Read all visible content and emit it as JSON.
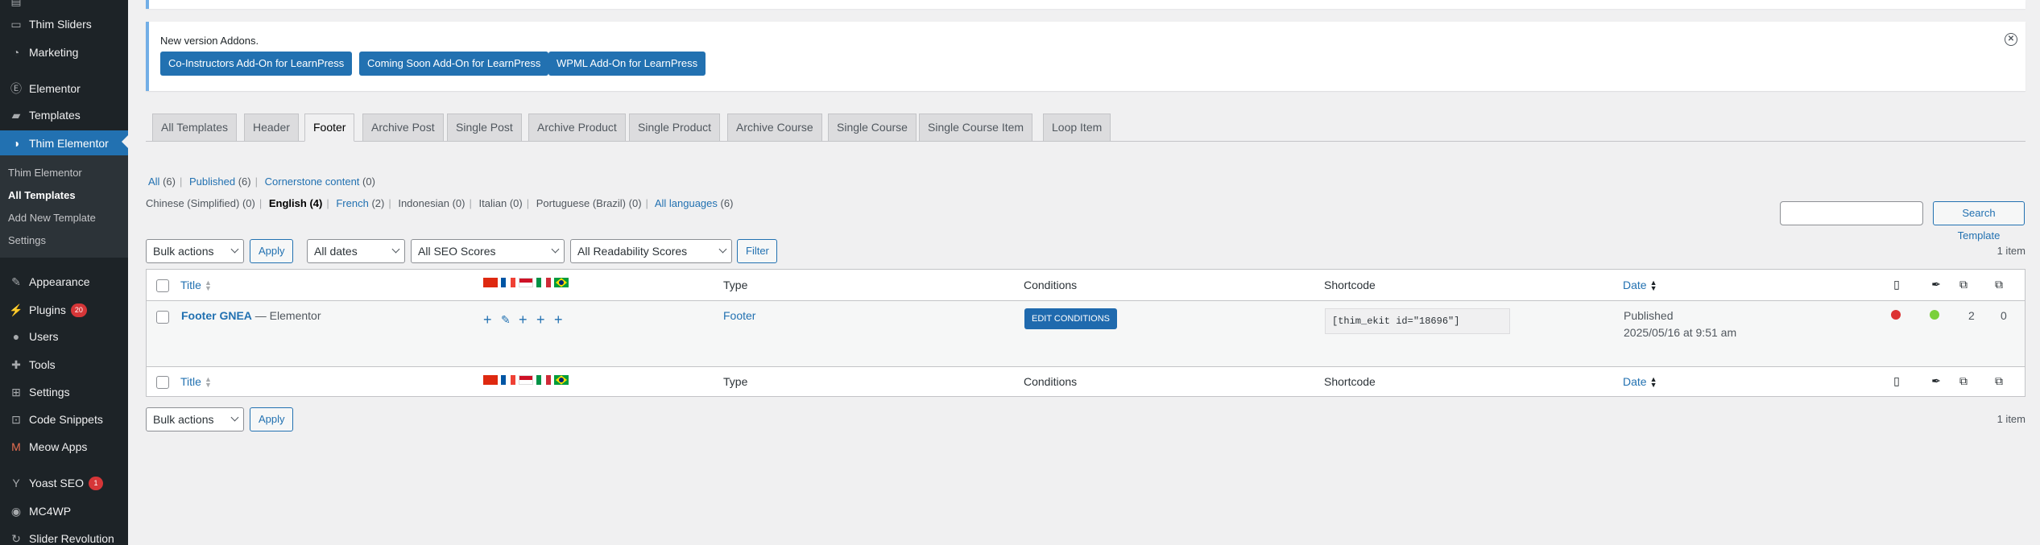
{
  "sidebar": {
    "items": [
      {
        "label": "Thim Sliders",
        "icon": "slider-icon",
        "glyph": "▭"
      },
      {
        "label": "Marketing",
        "icon": "marketing-icon",
        "glyph": "◔"
      },
      {
        "label": "Elementor",
        "icon": "elementor-icon",
        "glyph": "Ⓔ"
      },
      {
        "label": "Templates",
        "icon": "folder-icon",
        "glyph": "▰"
      },
      {
        "label": "Thim Elementor",
        "icon": "thim-icon",
        "glyph": "◑"
      },
      {
        "label": "Appearance",
        "icon": "brush-icon",
        "glyph": "✎"
      },
      {
        "label": "Plugins",
        "icon": "plug-icon",
        "glyph": "⚡",
        "badge": "20"
      },
      {
        "label": "Users",
        "icon": "user-icon",
        "glyph": "●"
      },
      {
        "label": "Tools",
        "icon": "wrench-icon",
        "glyph": "✚"
      },
      {
        "label": "Settings",
        "icon": "settings-icon",
        "glyph": "⊞"
      },
      {
        "label": "Code Snippets",
        "icon": "code-icon",
        "glyph": "⊡"
      },
      {
        "label": "Meow Apps",
        "icon": "meow-icon",
        "glyph": "M"
      },
      {
        "label": "Yoast SEO",
        "icon": "yoast-icon",
        "glyph": "Y",
        "badge": "1"
      },
      {
        "label": "MC4WP",
        "icon": "mc4wp-icon",
        "glyph": "◉"
      },
      {
        "label": "Slider Revolution",
        "icon": "revolution-icon",
        "glyph": "↻"
      }
    ],
    "submenu": [
      "Thim Elementor",
      "All Templates",
      "Add New Template",
      "Settings"
    ]
  },
  "notice": {
    "title": "New version Addons.",
    "buttons": [
      "Co-Instructors Add-On for LearnPress",
      "Coming Soon Add-On for LearnPress",
      "WPML Add-On for LearnPress"
    ]
  },
  "tabs": [
    "All Templates",
    "Header",
    "Footer",
    "Archive Post",
    "Single Post",
    "Archive Product",
    "Single Product",
    "Archive Course",
    "Single Course",
    "Single Course Item",
    "Loop Item"
  ],
  "status_links": {
    "all": "All",
    "all_count": "(6)",
    "published": "Published",
    "published_count": "(6)",
    "cornerstone": "Cornerstone content",
    "cornerstone_count": "(0)"
  },
  "language_links": {
    "chinese": "Chinese (Simplified)",
    "chinese_count": "(0)",
    "english": "English",
    "english_count": "(4)",
    "french": "French",
    "french_count": "(2)",
    "indonesian": "Indonesian",
    "indonesian_count": "(0)",
    "italian": "Italian",
    "italian_count": "(0)",
    "portuguese": "Portuguese (Brazil)",
    "portuguese_count": "(0)",
    "all": "All languages",
    "all_count": "(6)"
  },
  "search": {
    "button": "Search Template",
    "value": ""
  },
  "filters": {
    "bulk_actions": "Bulk actions",
    "apply": "Apply",
    "dates": "All dates",
    "seo": "All SEO Scores",
    "readability": "All Readability Scores",
    "filter": "Filter",
    "items": "1 item"
  },
  "table": {
    "columns": {
      "title": "Title",
      "type": "Type",
      "conditions": "Conditions",
      "shortcode": "Shortcode",
      "date": "Date"
    },
    "rows": [
      {
        "title": "Footer GNEA",
        "title_suffix": "— Elementor",
        "type": "Footer",
        "conditions_button": "EDIT CONDITIONS",
        "shortcode": "[thim_ekit id=\"18696\"]",
        "status": "Published",
        "date": "2025/05/16 at 9:51 am",
        "seo_color": "#dc3232",
        "readability_color": "#7ad03a",
        "internal_links": "2",
        "incoming_links": "0"
      }
    ]
  },
  "colors": {
    "accent": "#2271b1",
    "sidebar": "#1d2327"
  }
}
